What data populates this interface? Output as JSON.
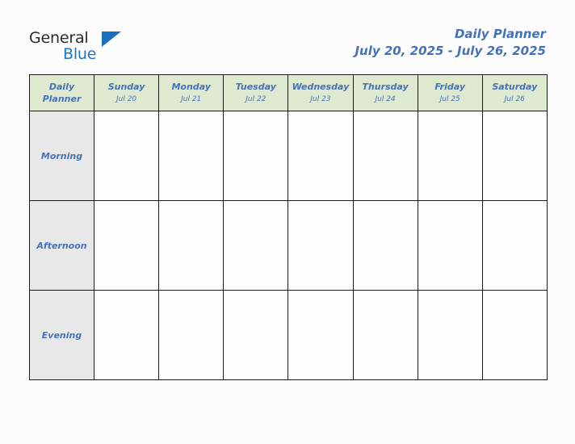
{
  "brand": {
    "logo_text_primary": "General",
    "logo_text_secondary": "Blue",
    "logo_triangle_icon": "triangle-icon",
    "primary_color": "#1a76c6",
    "dark_text_color": "#2b2b2b"
  },
  "header": {
    "title": "Daily Planner",
    "date_range": "July 20, 2025 - July 26, 2025",
    "title_color": "#4472b8"
  },
  "planner": {
    "corner_label": "Daily Planner",
    "header_bg": "#dfe9d0",
    "row_label_bg": "#e8e8e8",
    "cell_bg": "#fdfdfd",
    "border_color": "#1a1a1a",
    "columns": [
      {
        "day": "Sunday",
        "date": "Jul 20"
      },
      {
        "day": "Monday",
        "date": "Jul 21"
      },
      {
        "day": "Tuesday",
        "date": "Jul 22"
      },
      {
        "day": "Wednesday",
        "date": "Jul 23"
      },
      {
        "day": "Thursday",
        "date": "Jul 24"
      },
      {
        "day": "Friday",
        "date": "Jul 25"
      },
      {
        "day": "Saturday",
        "date": "Jul 26"
      }
    ],
    "rows": [
      {
        "label": "Morning",
        "entries": [
          "",
          "",
          "",
          "",
          "",
          "",
          ""
        ]
      },
      {
        "label": "Afternoon",
        "entries": [
          "",
          "",
          "",
          "",
          "",
          "",
          ""
        ]
      },
      {
        "label": "Evening",
        "entries": [
          "",
          "",
          "",
          "",
          "",
          "",
          ""
        ]
      }
    ]
  }
}
